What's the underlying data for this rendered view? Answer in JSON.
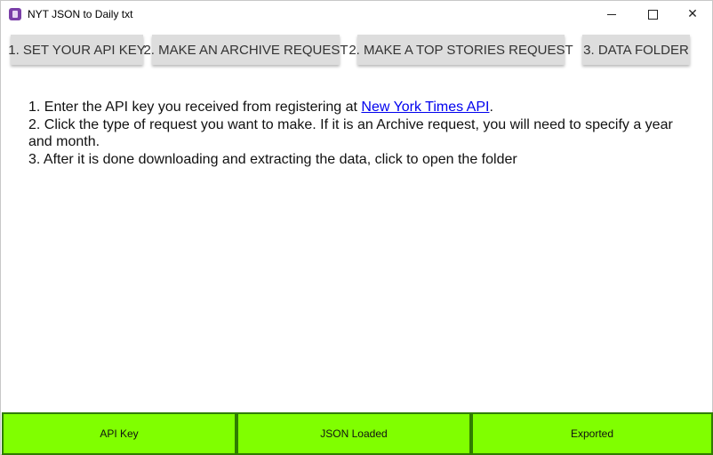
{
  "window": {
    "title": "NYT JSON to Daily txt",
    "icon": "app-icon",
    "controls": [
      "minimize-icon",
      "maximize-icon",
      "close-icon"
    ]
  },
  "toolbar": {
    "set_api_key": "1. SET YOUR API KEY",
    "archive_request": "2. MAKE AN ARCHIVE REQUEST",
    "top_stories_request": "2. MAKE A TOP STORIES REQUEST",
    "data_folder": "3. DATA FOLDER"
  },
  "instructions": {
    "line1_prefix": "1. Enter the API key you received from registering at ",
    "line1_link": "New York Times API",
    "line1_suffix": ".",
    "line2": "2. Click the type of request you want to make. If it is an Archive request, you will need to specify a year and month.",
    "line3": "3. After it is done downloading and extracting the data, click to open the folder"
  },
  "status": {
    "api_key": "API Key",
    "json_loaded": "JSON Loaded",
    "exported": "Exported"
  },
  "colors": {
    "status_fill": "#80ff00",
    "status_border": "#2f7d00",
    "button_bg": "#dddddd",
    "link": "#0000ee"
  }
}
